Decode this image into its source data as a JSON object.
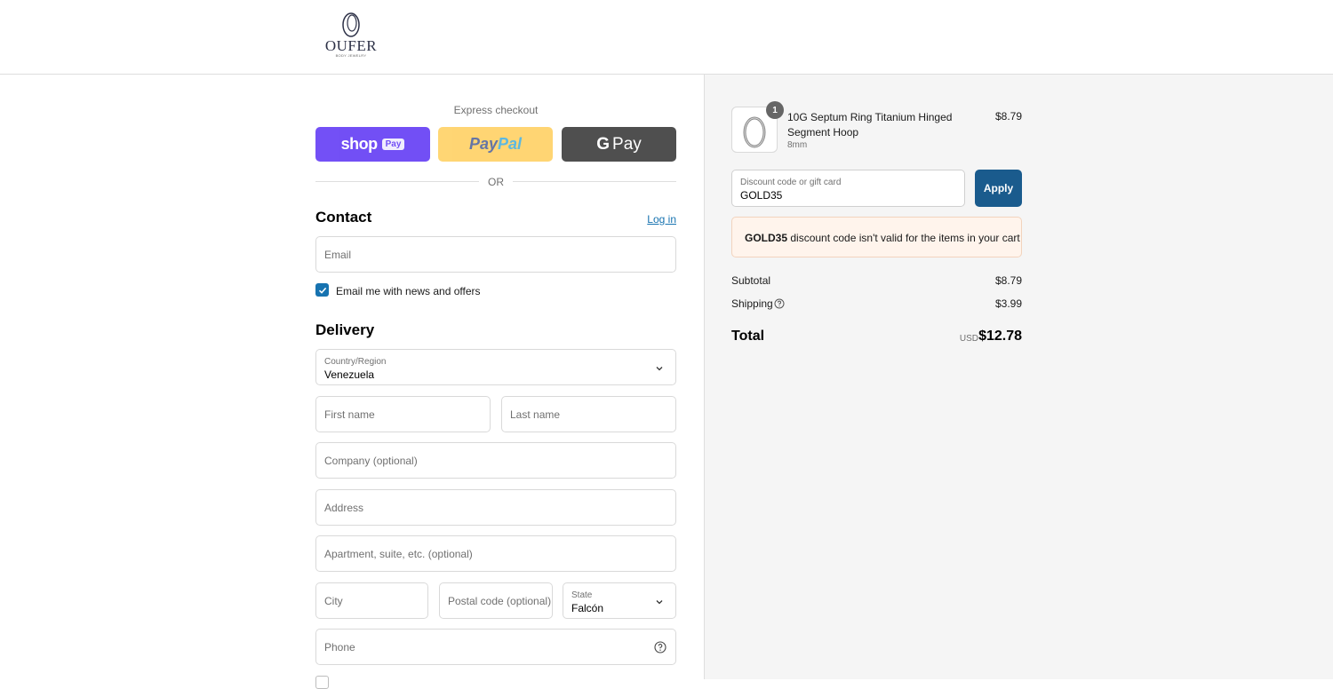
{
  "brand": {
    "name": "OUFER",
    "tagline": "BODY JEWELRY"
  },
  "express": {
    "title": "Express checkout",
    "shop_pay": {
      "word": "shop",
      "badge": "Pay"
    },
    "paypal": {
      "part1": "Pay",
      "part2": "Pal"
    },
    "gpay": {
      "g": "G",
      "word": "Pay"
    },
    "or": "OR"
  },
  "contact": {
    "title": "Contact",
    "login": "Log in",
    "email_placeholder": "Email",
    "newsletter_label": "Email me with news and offers",
    "newsletter_checked": true
  },
  "delivery": {
    "title": "Delivery",
    "country_label": "Country/Region",
    "country_value": "Venezuela",
    "first_name": "First name",
    "last_name": "Last name",
    "company": "Company (optional)",
    "address": "Address",
    "apartment": "Apartment, suite, etc. (optional)",
    "city": "City",
    "postal": "Postal code (optional)",
    "state_label": "State",
    "state_value": "Falcón",
    "phone": "Phone"
  },
  "summary": {
    "product": {
      "name": "10G Septum Ring Titanium Hinged Segment Hoop",
      "variant": "8mm",
      "price": "$8.79",
      "quantity": "1"
    },
    "discount": {
      "label": "Discount code or gift card",
      "value": "GOLD35",
      "apply": "Apply",
      "error_code": "GOLD35",
      "error_message": " discount code isn't valid for the items in your cart"
    },
    "subtotal_label": "Subtotal",
    "subtotal_value": "$8.79",
    "shipping_label": "Shipping",
    "shipping_value": "$3.99",
    "total_label": "Total",
    "total_currency": "USD",
    "total_value": "$12.78"
  },
  "colors": {
    "accent": "#1773b0",
    "apply_button": "#1a5b8d",
    "shop_pay": "#5a31f4",
    "paypal": "#ffc439",
    "gpay": "#3c3c3c",
    "error_bg": "#fff4ec"
  }
}
